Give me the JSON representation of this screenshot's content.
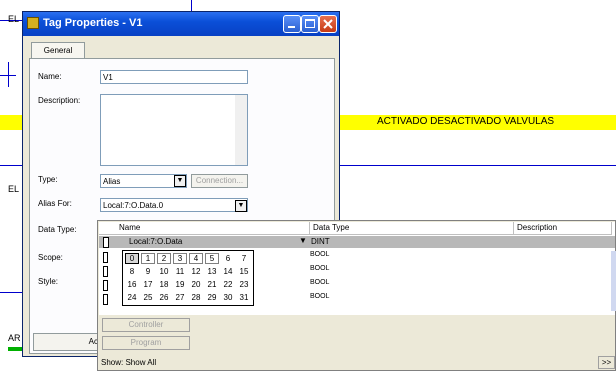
{
  "background": {
    "rung_labels": [
      "EL",
      "EL",
      "AR"
    ],
    "comment": "ACTIVADO DESACTIVADO VALVULAS"
  },
  "dialog": {
    "title": "Tag Properties - V1",
    "tab": "General",
    "name_label": "Name:",
    "name_value": "V1",
    "description_label": "Description:",
    "type_label": "Type:",
    "type_value": "Alias",
    "connection_button": "Connection...",
    "alias_for_label": "Alias For:",
    "alias_for_value": "Local:7:O.Data.0",
    "data_type_label": "Data Type:",
    "scope_label": "Scope:",
    "style_label": "Style:",
    "ok_button_partial": "Ac"
  },
  "browser": {
    "columns": [
      "Name",
      "Data Type",
      "Description"
    ],
    "selected_row": {
      "name": "Local:7:O.Data",
      "data_type": "DINT"
    },
    "bit_rows": [
      {
        "bits": [
          "0",
          "1",
          "2",
          "3",
          "4",
          "5",
          "6",
          "7"
        ],
        "data_type": "BOOL"
      },
      {
        "bits": [
          "8",
          "9",
          "10",
          "11",
          "12",
          "13",
          "14",
          "15"
        ],
        "data_type": "BOOL"
      },
      {
        "bits": [
          "16",
          "17",
          "18",
          "19",
          "20",
          "21",
          "22",
          "23"
        ],
        "data_type": "BOOL"
      },
      {
        "bits": [
          "24",
          "25",
          "26",
          "27",
          "28",
          "29",
          "30",
          "31"
        ],
        "data_type": "BOOL"
      }
    ],
    "selected_bit": "0",
    "controller_button": "Controller",
    "program_button": "Program",
    "show_label": "Show: Show All",
    "expand_button": ">>"
  },
  "colors": {
    "titlebar": "#0a4fd8",
    "comment_bar": "#ffff00",
    "wire": "#0000cc"
  }
}
